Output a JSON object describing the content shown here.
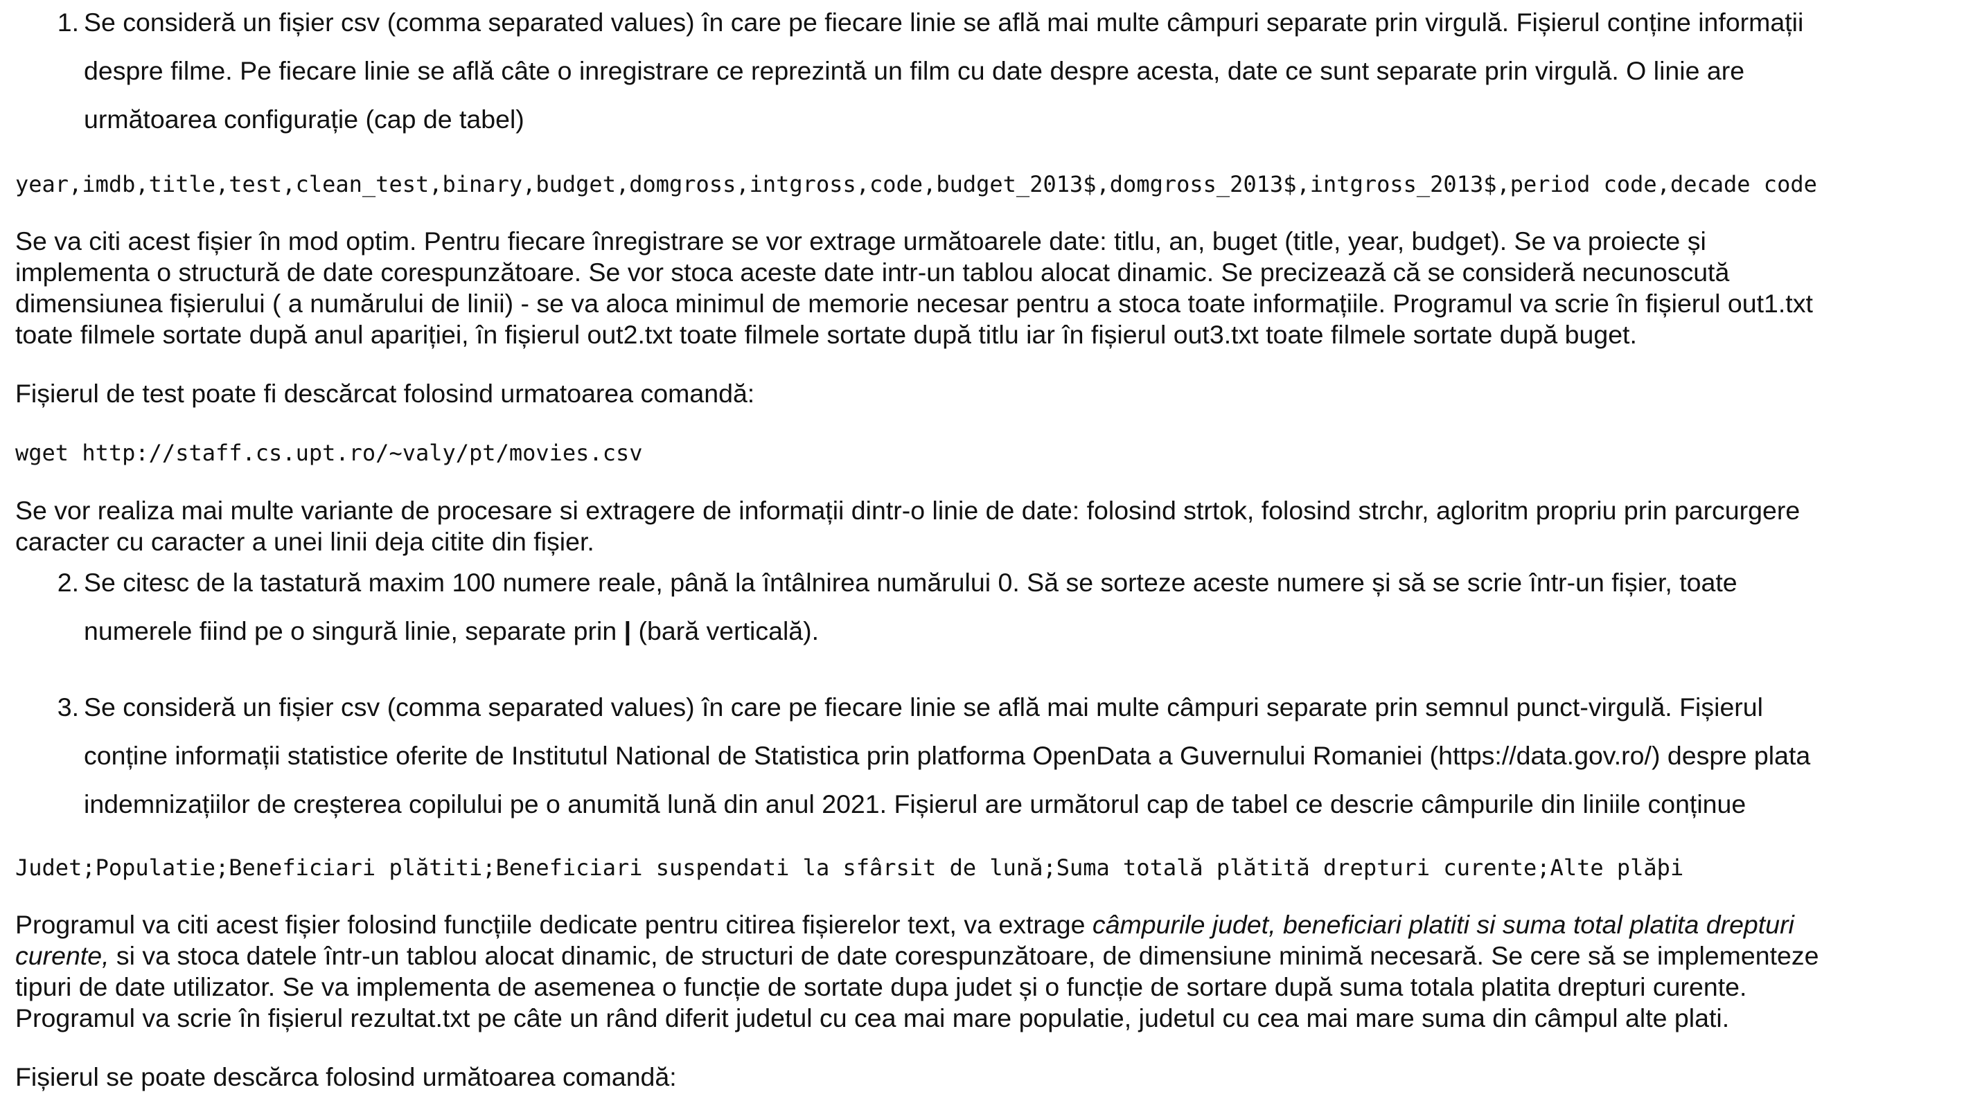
{
  "item1": {
    "number": "1.",
    "lines": [
      "Se consideră un fișier csv (comma separated values) în care pe fiecare linie se află mai multe câmpuri separate prin virgulă. Fișierul conține informații",
      "despre filme. Pe fiecare linie se află câte o inregistrare ce reprezintă un film cu date despre acesta, date ce sunt separate prin virgulă. O linie are",
      "următoarea configurație (cap de tabel)"
    ]
  },
  "code1": "year,imdb,title,test,clean_test,binary,budget,domgross,intgross,code,budget_2013$,domgross_2013$,intgross_2013$,period code,decade code",
  "para1": {
    "lines": [
      "Se va citi acest fișier în mod optim. Pentru fiecare înregistrare se vor extrage următoarele date: titlu, an, buget (title, year, budget). Se va proiecte și",
      "implementa o structură de date corespunzătoare. Se vor stoca aceste date intr-un tablou alocat dinamic. Se precizează că se consideră necunoscută",
      "dimensiunea fișierului ( a numărului de linii) - se va aloca minimul de memorie necesar pentru a stoca toate informațiile. Programul va scrie în fișierul out1.txt",
      "toate filmele sortate după anul apariției, în fișierul out2.txt toate filmele sortate după titlu iar în fișierul out3.txt toate filmele sortate după buget."
    ]
  },
  "para2": "Fișierul de test poate fi descărcat folosind urmatoarea comandă:",
  "code2": "wget http://staff.cs.upt.ro/~valy/pt/movies.csv",
  "para3": {
    "lines": [
      "Se vor realiza mai multe variante de procesare si extragere de informații dintr-o linie de date: folosind strtok, folosind strchr, agloritm propriu prin parcurgere",
      "caracter cu caracter a unei linii deja citite din fișier."
    ]
  },
  "item2": {
    "number": "2.",
    "line1": "Se citesc de la tastatură maxim 100 numere reale, până la întâlnirea numărului 0. Să se sorteze aceste numere și să se scrie într-un fișier, toate",
    "line2_before": "numerele fiind pe o singură linie, separate prin ",
    "line2_bar": "|",
    "line2_after": " (bară verticală)."
  },
  "item3": {
    "number": "3.",
    "lines": [
      "Se consideră un fișier csv (comma separated values) în care pe fiecare linie se află mai multe câmpuri separate prin semnul punct-virgulă. Fișierul",
      "conține informații statistice oferite de Institutul National de Statistica prin platforma OpenData a Guvernului Romaniei (https://data.gov.ro/) despre plata",
      "indemnizațiilor de creșterea copilului pe o anumită lună din anul 2021. Fișierul are următorul cap de tabel ce descrie câmpurile din liniile conținue"
    ]
  },
  "code3": "Judet;Populatie;Beneficiari plătiti;Beneficiari suspendati la sfârsit de lună;Suma totală plătită drepturi curente;Alte plăþi",
  "para4": {
    "line1_before": "Programul va citi acest fișier folosind funcțiile dedicate pentru citirea fișierelor text, va extrage ",
    "line1_italic": "câmpurile judet, beneficiari platiti si suma total platita drepturi",
    "line2_italic": "curente,",
    "line2_after": " si va stoca datele într-un tablou alocat dinamic, de structuri de date corespunzătoare, de dimensiune minimă necesară. Se cere să se implementeze",
    "line3": "tipuri de date utilizator. Se va implementa de asemenea o funcție de sortate dupa judet și o funcție de sortare după suma totala platita drepturi curente.",
    "line4": "Programul va scrie în fișierul rezultat.txt pe câte un rând diferit judetul cu cea mai mare populatie, judetul cu cea mai mare suma din câmpul alte plati."
  },
  "para5": "Fișierul se poate descărca folosind următoarea comandă:"
}
